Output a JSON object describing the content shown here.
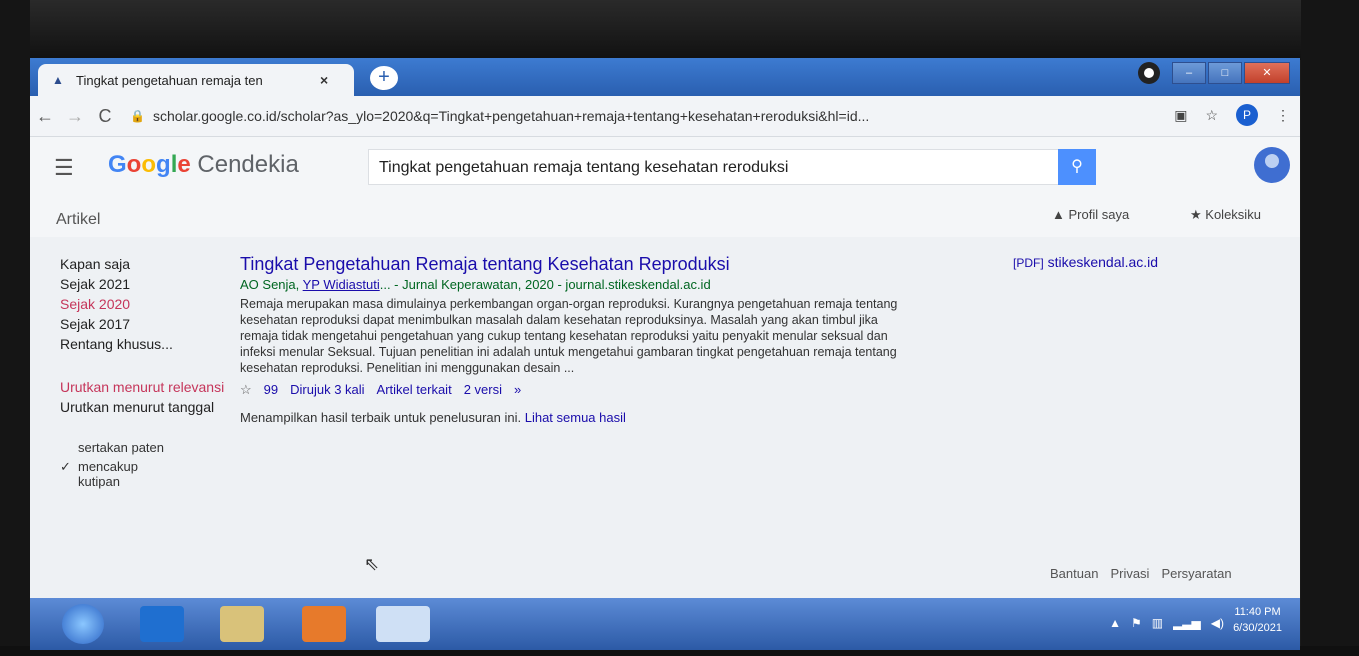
{
  "browser": {
    "tab_title": "Tingkat pengetahuan remaja ten",
    "tab_close": "×",
    "new_tab": "+",
    "url": "scholar.google.co.id/scholar?as_ylo=2020&q=Tingkat+pengetahuan+remaja+tentang+kesehatan+reroduksi&hl=id...",
    "profile_letter": "P"
  },
  "scholar": {
    "logo_google": "Google",
    "logo_suffix": "Cendekia",
    "search_query": "Tingkat pengetahuan remaja tentang kesehatan reroduksi",
    "section_label": "Artikel",
    "profil_label": "Profil saya",
    "koleksi_label": "Koleksiku"
  },
  "sidebar": {
    "time_filters": [
      {
        "label": "Kapan saja",
        "active": false
      },
      {
        "label": "Sejak 2021",
        "active": false
      },
      {
        "label": "Sejak 2020",
        "active": true
      },
      {
        "label": "Sejak 2017",
        "active": false
      },
      {
        "label": "Rentang khusus...",
        "active": false
      }
    ],
    "sort_relevance": "Urutkan menurut relevansi",
    "sort_date": "Urutkan menurut tanggal",
    "include_patents": "sertakan paten",
    "include_citations": "mencakup kutipan"
  },
  "result": {
    "title": "Tingkat Pengetahuan Remaja tentang Kesehatan Reproduksi",
    "authors_plain": "AO Senja, ",
    "author_link": "YP Widiastuti",
    "meta_rest": "... - Jurnal Keperawatan, 2020 - journal.stikeskendal.ac.id",
    "snippet": "Remaja merupakan masa dimulainya perkembangan organ-organ reproduksi. Kurangnya pengetahuan remaja tentang kesehatan reproduksi dapat menimbulkan masalah dalam kesehatan reproduksinya. Masalah yang akan timbul jika remaja tidak mengetahui pengetahuan yang cukup tentang kesehatan reproduksi yaitu penyakit menular seksual dan infeksi menular Seksual. Tujuan penelitian ini adalah untuk mengetahui gambaran tingkat pengetahuan remaja tentang kesehatan reproduksi. Penelitian ini menggunakan desain ...",
    "cite_label": "99",
    "cited_by": "Dirujuk 3 kali",
    "related": "Artikel terkait",
    "versions": "2 versi",
    "pdf_tag": "[PDF]",
    "pdf_source": "stikeskendal.ac.id"
  },
  "notice": {
    "text": "Menampilkan hasil terbaik untuk penelusuran ini. ",
    "link": "Lihat semua hasil"
  },
  "footer": {
    "help": "Bantuan",
    "privacy": "Privasi",
    "terms": "Persyaratan"
  },
  "taskbar": {
    "time": "11:40 PM",
    "date": "6/30/2021"
  }
}
